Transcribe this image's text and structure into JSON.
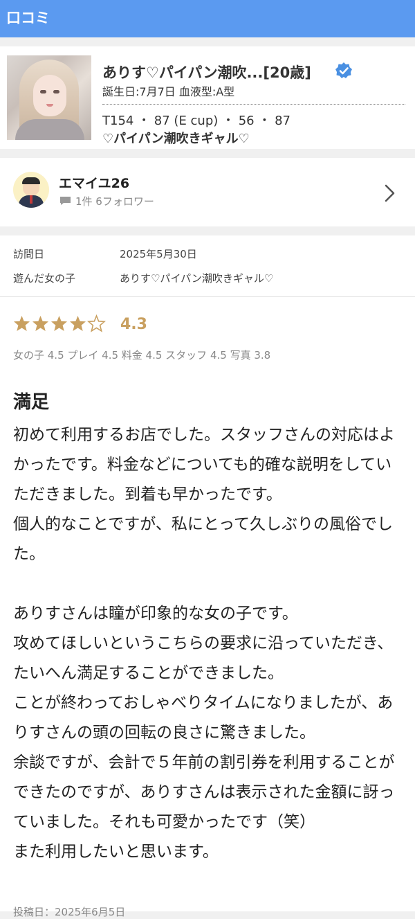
{
  "header": {
    "title": "口コミ"
  },
  "profile": {
    "name": "ありす♡パイパン潮吹...[20歳]",
    "birth_blood": "誕生日:7月7日 血液型:A型",
    "measurements": "T154 ・ 87 (E cup) ・ 56 ・ 87",
    "catchphrase": "♡パイパン潮吹きギャル♡",
    "verified_icon": "verified-check-icon",
    "accent": "#4a90e2"
  },
  "reviewer": {
    "name": "エマイユ26",
    "stats": "1件  6フォロワー"
  },
  "visit": {
    "date_label": "訪問日",
    "date_value": "2025年5月30日",
    "girl_label": "遊んだ女の子",
    "girl_value": "ありす♡パイパン潮吹きギャル♡"
  },
  "rating": {
    "stars_filled": 4,
    "stars_total": 5,
    "score": "4.3",
    "star_color": "#c9a060",
    "subscores": "女の子 4.5 プレイ 4.5 料金 4.5 スタッフ 4.5 写真 3.8"
  },
  "review": {
    "title": "満足",
    "body": "初めて利用するお店でした。スタッフさんの対応はよかったです。料金などについても的確な説明をしていただきました。到着も早かったです。\n個人的なことですが、私にとって久しぶりの風俗でした。\n\nありすさんは瞳が印象的な女の子です。\n攻めてほしいというこちらの要求に沿っていただき、たいへん満足することができました。\nことが終わっておしゃべりタイムになりましたが、ありすさんの頭の回転の良さに驚きました。\n余談ですが、会計で５年前の割引券を利用することができたのですが、ありすさんは表示された金額に訝っていました。それも可愛かったです（笑）\nまた利用したいと思います。",
    "posted": "投稿日：2025年6月5日"
  }
}
